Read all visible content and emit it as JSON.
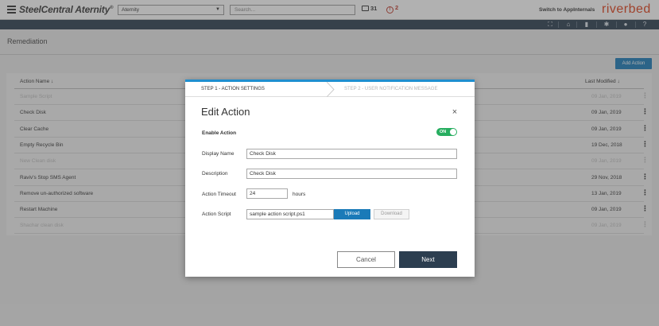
{
  "topbar": {
    "brand": "SteelCentral Aternity",
    "brand_mark": "®",
    "app_select_value": "Aternity",
    "search_placeholder": "Search...",
    "messages_count": "31",
    "alerts_count": "2",
    "switch_label": "Switch to AppInternals",
    "logo": "riverbed",
    "accent_color": "#e1401b"
  },
  "toolbar_icons": [
    "expand-icon",
    "home-icon",
    "book-icon",
    "gear-icon",
    "user-icon",
    "help-icon"
  ],
  "page": {
    "title": "Remediation",
    "add_button": "Add Action"
  },
  "table": {
    "col_name": "Action Name",
    "col_modified": "Last Modified",
    "rows": [
      {
        "name": "Sample Script",
        "date": "09 Jan, 2019",
        "dim": true
      },
      {
        "name": "Check Disk",
        "date": "09 Jan, 2019",
        "dim": false
      },
      {
        "name": "Clear Cache",
        "date": "09 Jan, 2019",
        "dim": false
      },
      {
        "name": "Empty Recycle Bin",
        "date": "19 Dec, 2018",
        "dim": false
      },
      {
        "name": "New Clean disk",
        "date": "09 Jan, 2019",
        "dim": true
      },
      {
        "name": "Raviv's Stop SMS Agent",
        "date": "29 Nov, 2018",
        "dim": false
      },
      {
        "name": "Remove un-authorized software",
        "date": "13 Jan, 2019",
        "dim": false
      },
      {
        "name": "Restart Machine",
        "date": "09 Jan, 2019",
        "dim": false
      },
      {
        "name": "Shachar clean disk",
        "date": "09 Jan, 2019",
        "dim": true
      }
    ]
  },
  "modal": {
    "step1": "STEP 1 - ACTION SETTINGS",
    "step2": "STEP 2 - USER NOTIFICATION MESSAGE",
    "title": "Edit Action",
    "close": "×",
    "enable_label": "Enable Action",
    "toggle_text": "ON",
    "display_name_label": "Display Name",
    "display_name_value": "Check Disk",
    "description_label": "Description",
    "description_value": "Check Disk",
    "timeout_label": "Action Timeout",
    "timeout_value": "24",
    "timeout_units": "hours",
    "script_label": "Action Script",
    "script_value": "sample action script.ps1",
    "upload": "Upload",
    "download": "Download",
    "cancel": "Cancel",
    "next": "Next",
    "accent_color": "#1f8fcf"
  }
}
